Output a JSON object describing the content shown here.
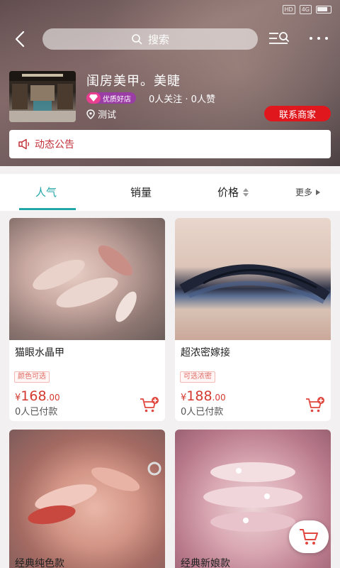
{
  "header": {
    "search_placeholder": "搜索"
  },
  "store": {
    "name": "闺房美甲。美睫",
    "badge": "优质好店",
    "follow_stats": "0人关注 · 0人赞",
    "location": "测试",
    "contact_label": "联系商家",
    "notice_label": "动态公告"
  },
  "tabs": {
    "popular": "人气",
    "sales": "销量",
    "price": "价格",
    "more": "更多"
  },
  "products": [
    {
      "title": "猫眼水晶甲",
      "tag": "颜色可选",
      "currency": "¥",
      "price_int": "168",
      "price_dec": ".00",
      "paid": "0人已付款"
    },
    {
      "title": "超浓密嫁接",
      "tag": "可选浓密",
      "currency": "¥",
      "price_int": "188",
      "price_dec": ".00",
      "paid": "0人已付款"
    },
    {
      "title": "经典纯色款"
    },
    {
      "title": "经典新娘款"
    }
  ],
  "colors": {
    "accent": "#22a6a8",
    "price": "#d43a2f",
    "contact_button": "#e0181e",
    "badge": "#9a3ea6"
  },
  "icons": {
    "back": "chevron-left-icon",
    "search": "search-icon",
    "list_search": "list-search-icon",
    "more": "more-dots-icon",
    "gem": "diamond-icon",
    "location": "location-pin-icon",
    "notice": "megaphone-icon",
    "sort": "sort-arrows-icon",
    "cart_add": "cart-add-icon",
    "cart": "cart-icon"
  }
}
